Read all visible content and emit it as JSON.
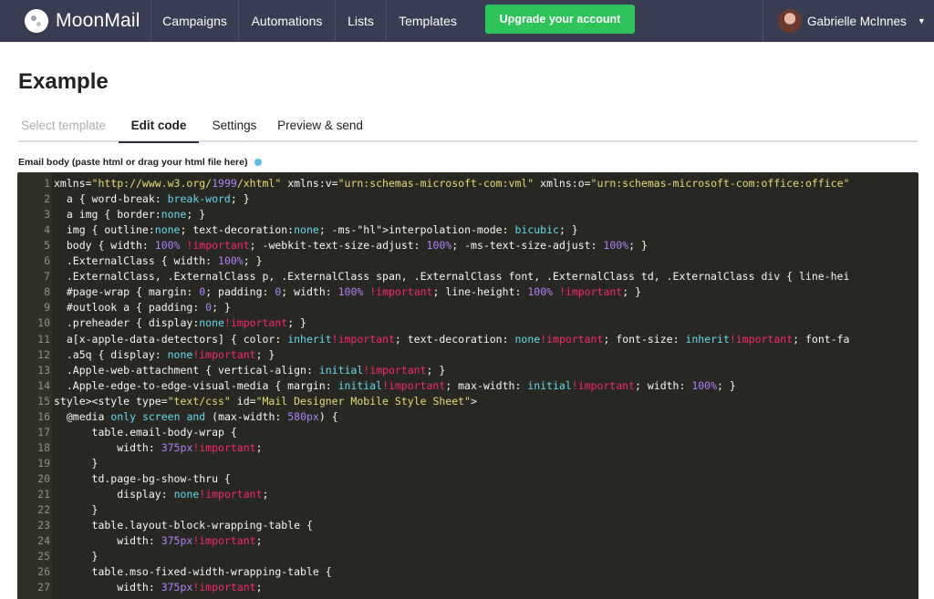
{
  "app": {
    "name": "MoonMail"
  },
  "nav": {
    "items": [
      {
        "label": "Campaigns"
      },
      {
        "label": "Automations"
      },
      {
        "label": "Lists"
      },
      {
        "label": "Templates"
      }
    ],
    "upgrade_label": "Upgrade your account",
    "user_name": "Gabrielle McInnes"
  },
  "page": {
    "title": "Example",
    "tabs": [
      {
        "label": "Select template"
      },
      {
        "label": "Edit code"
      },
      {
        "label": "Settings"
      },
      {
        "label": "Preview & send"
      }
    ],
    "active_tab": "Edit code",
    "field_label": "Email body (paste html or drag your html file here)"
  },
  "editor": {
    "lines": [
      {
        "n": "1",
        "text": "xmlns=\"http://www.w3.org/1999/xhtml\" xmlns:v=\"urn:schemas-microsoft-com:vml\" xmlns:o=\"urn:schemas-microsoft-com:office:office\""
      },
      {
        "n": "2",
        "text": "  a { word-break: break-word; }"
      },
      {
        "n": "3",
        "text": "  a img { border:none; }"
      },
      {
        "n": "4",
        "text": "  img { outline:none; text-decoration:none; -ms-interpolation-mode: bicubic; }"
      },
      {
        "n": "5",
        "text": "  body { width: 100% !important; -webkit-text-size-adjust: 100%; -ms-text-size-adjust: 100%; }"
      },
      {
        "n": "6",
        "text": "  .ExternalClass { width: 100%; }"
      },
      {
        "n": "7",
        "text": "  .ExternalClass, .ExternalClass p, .ExternalClass span, .ExternalClass font, .ExternalClass td, .ExternalClass div { line-hei"
      },
      {
        "n": "8",
        "text": "  #page-wrap { margin: 0; padding: 0; width: 100% !important; line-height: 100% !important; }"
      },
      {
        "n": "9",
        "text": "  #outlook a { padding: 0; }"
      },
      {
        "n": "10",
        "text": "  .preheader { display:none!important; }"
      },
      {
        "n": "11",
        "text": "  a[x-apple-data-detectors] { color: inherit!important; text-decoration: none!important; font-size: inherit!important; font-fa"
      },
      {
        "n": "12",
        "text": "  .a5q { display: none!important; }"
      },
      {
        "n": "13",
        "text": "  .Apple-web-attachment { vertical-align: initial!important; }"
      },
      {
        "n": "14",
        "text": "  .Apple-edge-to-edge-visual-media { margin: initial!important; max-width: initial!important; width: 100%; }"
      },
      {
        "n": "15",
        "text": "style><style type=\"text/css\" id=\"Mail Designer Mobile Style Sheet\">"
      },
      {
        "n": "16",
        "text": "  @media only screen and (max-width: 580px) {"
      },
      {
        "n": "17",
        "text": "      table.email-body-wrap {"
      },
      {
        "n": "18",
        "text": "          width: 375px!important;"
      },
      {
        "n": "19",
        "text": "      }"
      },
      {
        "n": "20",
        "text": "      td.page-bg-show-thru {"
      },
      {
        "n": "21",
        "text": "          display: none!important;"
      },
      {
        "n": "22",
        "text": "      }"
      },
      {
        "n": "23",
        "text": "      table.layout-block-wrapping-table {"
      },
      {
        "n": "24",
        "text": "          width: 375px!important;"
      },
      {
        "n": "25",
        "text": "      }"
      },
      {
        "n": "26",
        "text": "      table.mso-fixed-width-wrapping-table {"
      },
      {
        "n": "27",
        "text": "          width: 375px!important;"
      }
    ]
  },
  "colors": {
    "nav_bg": "#383d54",
    "upgrade_bg": "#2fc35b",
    "editor_bg": "#272822",
    "info_dot": "#5bc0eb"
  }
}
